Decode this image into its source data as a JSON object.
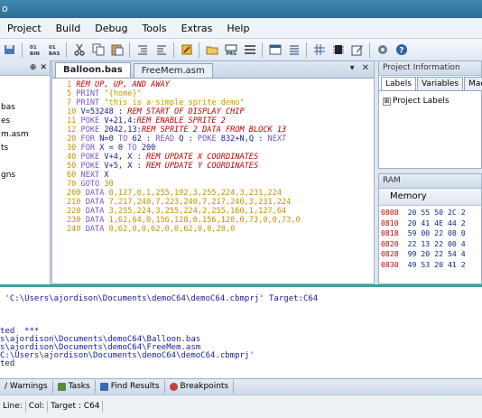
{
  "window": {
    "title": "o"
  },
  "menu": [
    "Project",
    "Build",
    "Debug",
    "Tools",
    "Extras",
    "Help"
  ],
  "left_panel": {
    "pin": "⊕",
    "close": "✕",
    "items": [
      "bas",
      "es",
      "m.asm",
      "ts",
      "",
      "gns"
    ]
  },
  "editor": {
    "tabs": [
      {
        "label": "Balloon.bas",
        "active": true
      },
      {
        "label": "FreeMem.asm",
        "active": false
      }
    ],
    "tab_dropdown": "▾",
    "tab_close": "✕",
    "lines": [
      [
        [
          "1",
          "num"
        ],
        [
          " REM UP, UP, AND AWAY",
          "rem"
        ]
      ],
      [
        [
          "5",
          "num"
        ],
        [
          " PRINT ",
          "key"
        ],
        [
          "\"{home}\"",
          "str"
        ]
      ],
      [
        [
          "7",
          "num"
        ],
        [
          " PRINT ",
          "key"
        ],
        [
          "\"this is a simple sprite demo\"",
          "str"
        ]
      ],
      [
        [
          "10",
          "num"
        ],
        [
          " V=53248 : ",
          "var"
        ],
        [
          "REM START OF DISPLAY CHIP",
          "rem"
        ]
      ],
      [
        [
          "11",
          "num"
        ],
        [
          " POKE ",
          "key"
        ],
        [
          "V+21,4:",
          "var"
        ],
        [
          "REM ENABLE SPRITE 2",
          "rem"
        ]
      ],
      [
        [
          "12",
          "num"
        ],
        [
          " POKE ",
          "key"
        ],
        [
          "2042,13:",
          "var"
        ],
        [
          "REM SPRITE 2 DATA FROM BLOCK 13",
          "rem"
        ]
      ],
      [
        [
          "20",
          "num"
        ],
        [
          " FOR ",
          "key"
        ],
        [
          "N=0 ",
          "var"
        ],
        [
          "TO ",
          "key"
        ],
        [
          "62 : ",
          "var"
        ],
        [
          "READ ",
          "key"
        ],
        [
          "Q : ",
          "var"
        ],
        [
          "POKE ",
          "key"
        ],
        [
          "832+N,Q : ",
          "var"
        ],
        [
          "NEXT",
          "key"
        ]
      ],
      [
        [
          "30",
          "num"
        ],
        [
          " FOR ",
          "key"
        ],
        [
          "X = 0 ",
          "var"
        ],
        [
          "TO ",
          "key"
        ],
        [
          "200",
          "var"
        ]
      ],
      [
        [
          "40",
          "num"
        ],
        [
          " POKE ",
          "key"
        ],
        [
          "V+4, X : ",
          "var"
        ],
        [
          "REM UPDATE X COORDINATES",
          "rem"
        ]
      ],
      [
        [
          "50",
          "num"
        ],
        [
          " POKE ",
          "key"
        ],
        [
          "V+5, X : ",
          "var"
        ],
        [
          "REM UPDATE Y COORDINATES",
          "rem"
        ]
      ],
      [
        [
          "60",
          "num"
        ],
        [
          " NEXT ",
          "key"
        ],
        [
          "X",
          "var"
        ]
      ],
      [
        [
          "70",
          "num"
        ],
        [
          " GOTO ",
          "key"
        ],
        [
          "30",
          "num"
        ]
      ],
      [
        [
          "200",
          "num"
        ],
        [
          " DATA ",
          "key"
        ],
        [
          "0,127,0,1,255,192,3,255,224,3,231,224",
          "num"
        ]
      ],
      [
        [
          "210",
          "num"
        ],
        [
          " DATA ",
          "key"
        ],
        [
          "7,217,240,7,223,240,7,217,240,3,231,224",
          "num"
        ]
      ],
      [
        [
          "220",
          "num"
        ],
        [
          " DATA ",
          "key"
        ],
        [
          "3,255,224,3,255,224,2,255,160,1,127,64",
          "num"
        ]
      ],
      [
        [
          "230",
          "num"
        ],
        [
          " DATA ",
          "key"
        ],
        [
          "1,62,64,0,156,128,0,156,128,0,73,0,0,73,0",
          "num"
        ]
      ],
      [
        [
          "240",
          "num"
        ],
        [
          " DATA ",
          "key"
        ],
        [
          "0,62,0,0,62,0,0,62,0,0,28,0",
          "num"
        ]
      ]
    ]
  },
  "project_info": {
    "title": "Project Information",
    "tabs": [
      "Labels",
      "Variables",
      "Macros"
    ],
    "active_tab": "Labels",
    "tree_expander": "⊞",
    "tree_item": "Project Labels"
  },
  "ram": {
    "title": "RAM",
    "header": "Memory",
    "rows": [
      {
        "addr": "",
        "bytes": ""
      },
      {
        "addr": "0808",
        "bytes": "20 55 50 2C 2"
      },
      {
        "addr": "0810",
        "bytes": "20 41 4E 44 2"
      },
      {
        "addr": "0818",
        "bytes": "59 00 22 08 0"
      },
      {
        "addr": "0820",
        "bytes": "22 13 22 00 4"
      },
      {
        "addr": "0828",
        "bytes": "99 20 22 54 4"
      },
      {
        "addr": "0830",
        "bytes": "49 53 20 41 2"
      }
    ]
  },
  "output_lines": [
    "",
    " 'C:\\Users\\ajordison\\Documents\\demoC64\\demoC64.cbmprj' Target:C64",
    "",
    "",
    "",
    "ted  ***",
    "s\\ajordison\\Documents\\demoC64\\Balloon.bas",
    "s\\ajordison\\Documents\\demoC64\\FreeMem.asm",
    "C:\\Users\\ajordison\\Documents\\demoC64\\demoC64.cbmprj'",
    "ted"
  ],
  "bottom_tabs": [
    {
      "label": "/ Warnings",
      "icon": "",
      "icon_color": ""
    },
    {
      "label": "Tasks",
      "icon": "check",
      "icon_color": "#5a8a3a"
    },
    {
      "label": "Find Results",
      "icon": "find",
      "icon_color": "#3a6ab0"
    },
    {
      "label": "Breakpoints",
      "icon": "break",
      "icon_color": "#c04040"
    }
  ],
  "status": {
    "line": "Line:",
    "col": "Col:",
    "target": "Target : C64"
  }
}
